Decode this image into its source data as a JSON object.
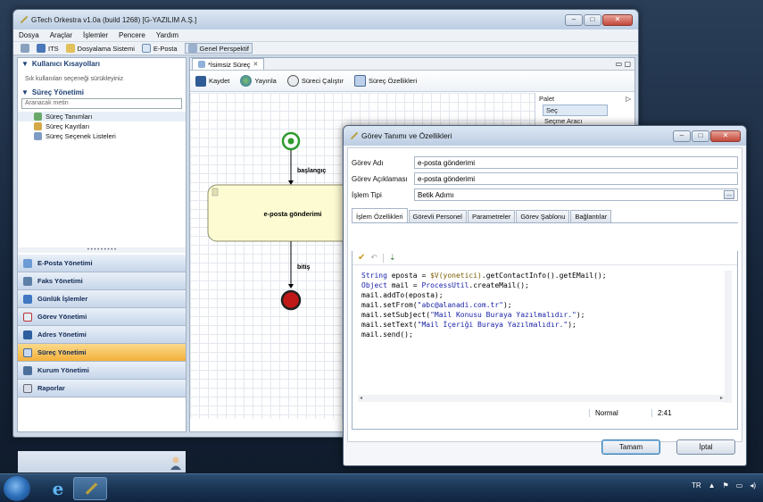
{
  "main_window": {
    "title": "GTech Orkestra v1.0a (build 1268) [G-YAZILIM A.Ş.]",
    "menu": [
      "Dosya",
      "Araçlar",
      "İşlemler",
      "Pencere",
      "Yardım"
    ],
    "toolbar": [
      "ITS",
      "Dosyalama Sistemi",
      "E-Posta",
      "Genel Perspektif"
    ]
  },
  "left_panel": {
    "shortcuts_title": "Kullanıcı Kısayolları",
    "shortcuts_hint": "Sık kullanılan seçeneği sürükleyiniz",
    "process_title": "Süreç Yönetimi",
    "search_placeholder": "Aranacak metin",
    "tree": [
      "Süreç Tanımları",
      "Süreç Kayıtları",
      "Süreç Seçenek Listeleri"
    ],
    "nav": [
      "E-Posta Yönetimi",
      "Faks Yönetimi",
      "Günlük İşlemler",
      "Görev Yönetimi",
      "Adres Yönetimi",
      "Süreç Yönetimi",
      "Kurum Yönetimi",
      "Raporlar"
    ]
  },
  "editor": {
    "tab": "*İsimsiz Süreç",
    "toolbar": [
      "Kaydet",
      "Yayınla",
      "Süreci Çalıştır",
      "Süreç Özellikleri"
    ],
    "palette_title": "Palet",
    "palette_items": [
      "Seç",
      "Seçme Aracı"
    ],
    "diagram": {
      "start_label": "başlangıç",
      "task_label": "e-posta gönderimi",
      "end_label": "bitiş"
    }
  },
  "dialog": {
    "title": "Görev Tanımı ve Özellikleri",
    "fields": [
      {
        "label": "Görev Adı",
        "value": "e-posta gönderimi"
      },
      {
        "label": "Görev Açıklaması",
        "value": "e-posta gönderimi"
      },
      {
        "label": "İşlem Tipi",
        "value": "Betik Adımı"
      }
    ],
    "tabs": [
      "İşlem Özellikleri",
      "Görevli Personel",
      "Parametreler",
      "Görev Şablonu",
      "Bağlantılar"
    ],
    "code_lines": [
      "String eposta = $V(yonetici).getContactInfo().getEMail();",
      "Object  mail = ProcessUtil.createMail();",
      "mail.addTo(eposta);",
      "mail.setFrom(\"abc@alanadi.com.tr\");",
      "mail.setSubject(\"Mail Konusu Buraya Yazılmalıdır.\");",
      "mail.setText(\"Mail İçeriği Buraya Yazılmalıdır.\");",
      "mail.send();"
    ],
    "status_mode": "Normal",
    "status_pos": "2:41",
    "ok_label": "Tamam",
    "cancel_label": "İptal"
  },
  "taskbar": {
    "language": "TR"
  },
  "colors": {
    "accent_nav_active": "#f3b13b",
    "start_event": "#2e9a2e",
    "end_event": "#c01818",
    "task_fill": "#fdfbd2"
  }
}
